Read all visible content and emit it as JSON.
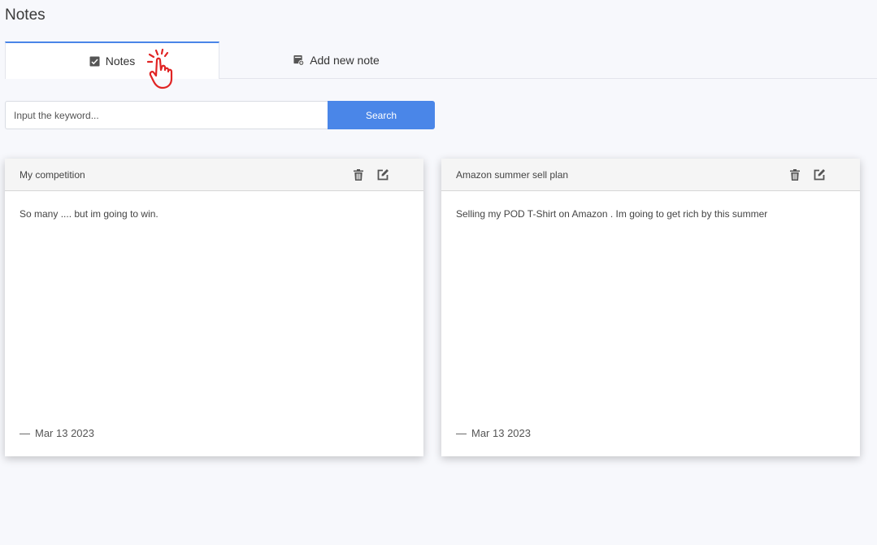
{
  "page": {
    "title": "Notes"
  },
  "tabs": [
    {
      "label": "Notes",
      "icon": "note-check-icon",
      "active": true
    },
    {
      "label": "Add new note",
      "icon": "note-add-icon",
      "active": false
    }
  ],
  "pointer": {
    "icon": "hand-pointer-icon",
    "color": "#e02424"
  },
  "search": {
    "placeholder": "Input the keyword...",
    "value": "",
    "button_label": "Search"
  },
  "notes": [
    {
      "title": "My competition",
      "content": "So many .... but im going to win.",
      "date": "Mar 13 2023",
      "date_prefix": "—"
    },
    {
      "title": "Amazon summer sell plan",
      "content": "Selling my POD T-Shirt on Amazon . Im going to get rich by this summer",
      "date": "Mar 13 2023",
      "date_prefix": "—"
    }
  ],
  "colors": {
    "accent": "#4a86e8",
    "background": "#f7f8fc",
    "card_header": "#f5f5f5"
  }
}
